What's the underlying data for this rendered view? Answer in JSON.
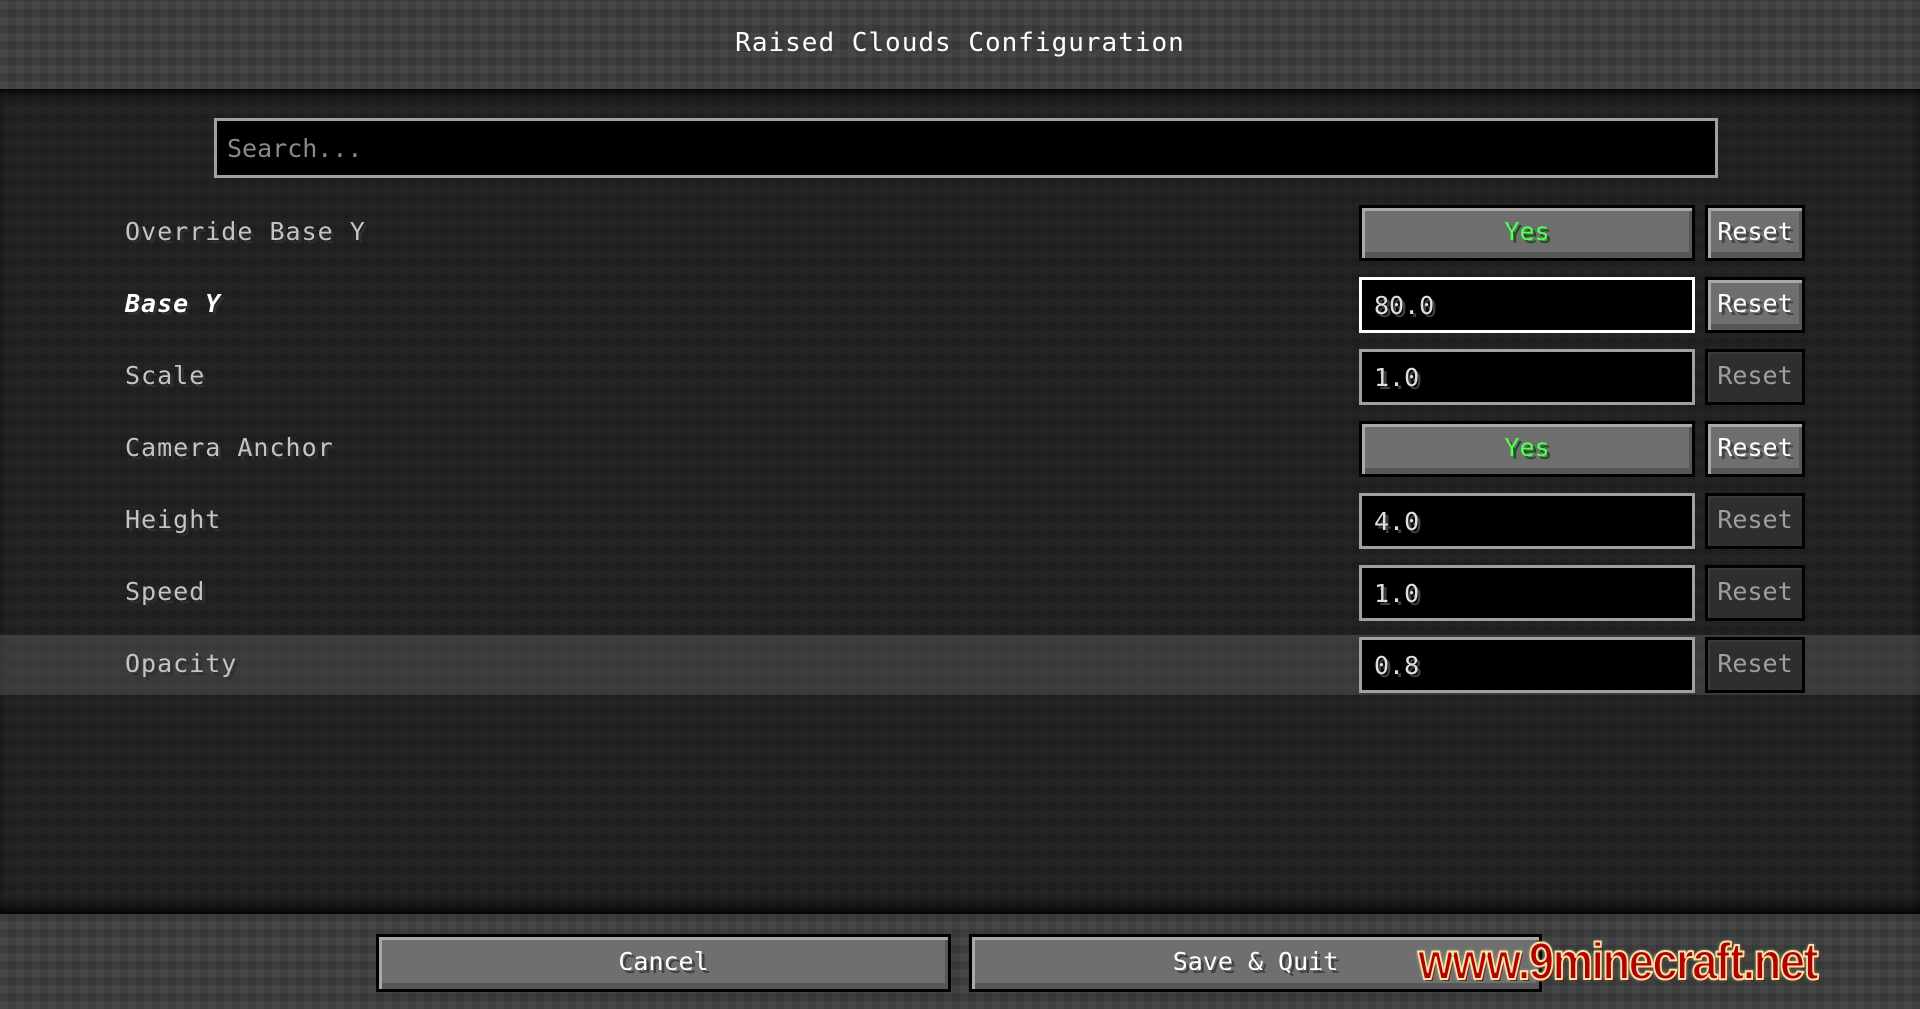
{
  "header": {
    "title": "Raised Clouds Configuration"
  },
  "search": {
    "placeholder": "Search...",
    "value": ""
  },
  "options": [
    {
      "label": "Override Base Y",
      "type": "toggle",
      "value": "Yes",
      "reset_label": "Reset",
      "reset_enabled": true,
      "active": false,
      "hovered": false
    },
    {
      "label": "Base Y",
      "type": "text",
      "value": "80.0",
      "reset_label": "Reset",
      "reset_enabled": true,
      "active": true,
      "focused": true,
      "hovered": false
    },
    {
      "label": "Scale",
      "type": "text",
      "value": "1.0",
      "reset_label": "Reset",
      "reset_enabled": false,
      "active": false,
      "hovered": false
    },
    {
      "label": "Camera Anchor",
      "type": "toggle",
      "value": "Yes",
      "reset_label": "Reset",
      "reset_enabled": true,
      "active": false,
      "hovered": false
    },
    {
      "label": "Height",
      "type": "text",
      "value": "4.0",
      "reset_label": "Reset",
      "reset_enabled": false,
      "active": false,
      "hovered": false
    },
    {
      "label": "Speed",
      "type": "text",
      "value": "1.0",
      "reset_label": "Reset",
      "reset_enabled": false,
      "active": false,
      "hovered": false
    },
    {
      "label": "Opacity",
      "type": "text",
      "value": "0.8",
      "reset_label": "Reset",
      "reset_enabled": false,
      "active": false,
      "hovered": true
    }
  ],
  "footer": {
    "cancel_label": "Cancel",
    "save_label": "Save & Quit"
  },
  "watermark": {
    "text": "www.9minecraft.net"
  },
  "colors": {
    "toggle_yes": "#55ff55",
    "text_primary": "#ffffff",
    "text_label": "#c4c4c4",
    "watermark_red": "#b30000"
  }
}
